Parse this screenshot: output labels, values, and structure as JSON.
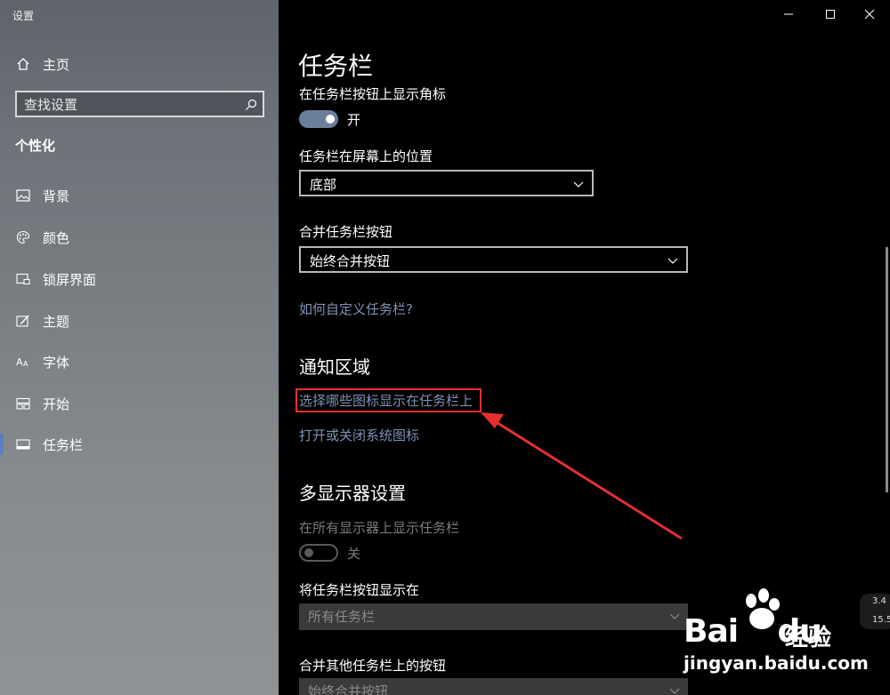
{
  "window": {
    "title": "设置",
    "controls": {
      "minimize": "—",
      "maximize": "☐",
      "close": "✕"
    }
  },
  "sidebar": {
    "home_label": "主页",
    "search_placeholder": "查找设置",
    "section_heading": "个性化",
    "items": [
      {
        "label": "背景",
        "icon": "image-icon"
      },
      {
        "label": "颜色",
        "icon": "palette-icon"
      },
      {
        "label": "锁屏界面",
        "icon": "lock-screen-icon"
      },
      {
        "label": "主题",
        "icon": "theme-icon"
      },
      {
        "label": "字体",
        "icon": "font-icon"
      },
      {
        "label": "开始",
        "icon": "start-icon"
      },
      {
        "label": "任务栏",
        "icon": "taskbar-icon",
        "active": true
      }
    ]
  },
  "main": {
    "page_title": "任务栏",
    "badge_setting": {
      "label": "在任务栏按钮上显示角标",
      "state": "开",
      "on": true
    },
    "position_setting": {
      "label": "任务栏在屏幕上的位置",
      "value": "底部"
    },
    "combine_setting": {
      "label": "合并任务栏按钮",
      "value": "始终合并按钮"
    },
    "customize_link": "如何自定义任务栏?",
    "notification_heading": "通知区域",
    "select_icons_link": "选择哪些图标显示在任务栏上",
    "system_icons_link": "打开或关闭系统图标",
    "multi_display_heading": "多显示器设置",
    "all_displays_setting": {
      "label": "在所有显示器上显示任务栏",
      "state": "关",
      "on": false
    },
    "show_buttons_on": {
      "label": "将任务栏按钮显示在",
      "value": "所有任务栏"
    },
    "combine_other": {
      "label": "合并其他任务栏上的按钮",
      "value": "始终合并按钮"
    }
  },
  "annotation": {
    "color": "#e53030"
  },
  "watermark": {
    "brand": "Bai",
    "brand2": "du",
    "cn": "经验",
    "url": "jingyan.baidu.com"
  },
  "side_widget": {
    "up_value": "3.4",
    "down_value": "15.5"
  },
  "colors": {
    "accent": "#5b7fbf",
    "link": "#7e91b4",
    "toggle_on": "#6b7f9a"
  }
}
